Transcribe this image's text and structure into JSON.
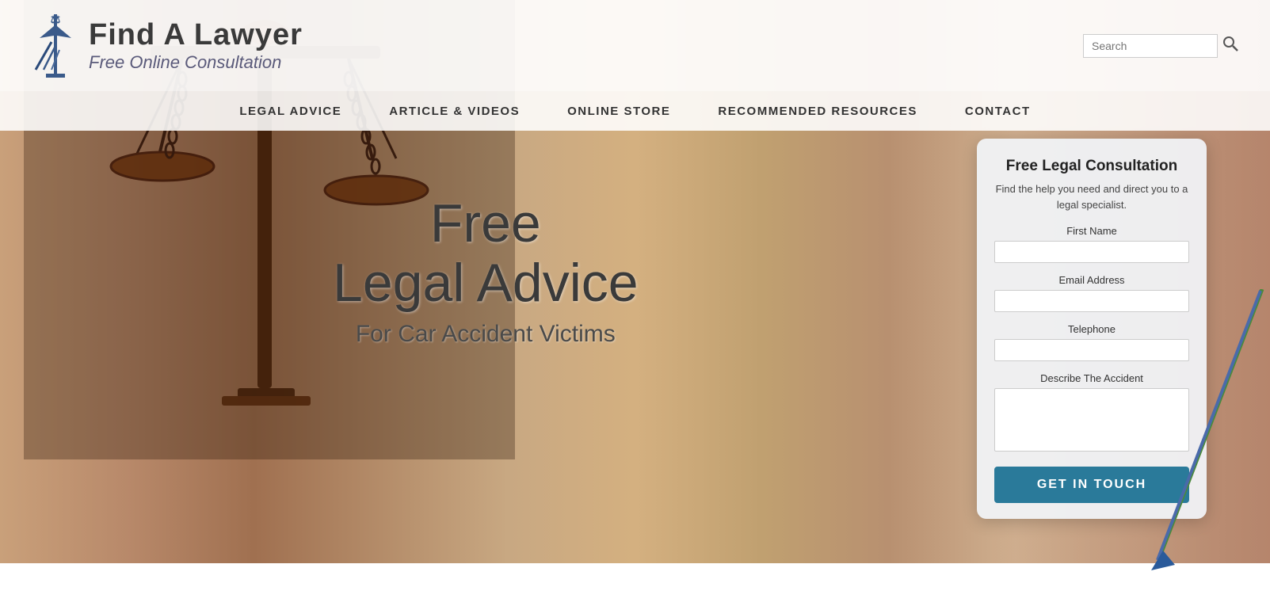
{
  "header": {
    "logo_title": "Find A Lawyer",
    "logo_subtitle": "Free Online Consultation",
    "search_placeholder": "Search",
    "search_icon": "🔍"
  },
  "nav": {
    "items": [
      {
        "label": "LEGAL ADVICE"
      },
      {
        "label": "ARTICLE & VIDEOS"
      },
      {
        "label": "ONLINE STORE"
      },
      {
        "label": "RECOMMENDED RESOURCES"
      },
      {
        "label": "CONTACT"
      }
    ]
  },
  "hero": {
    "line1": "Free",
    "line2": "Legal Advice",
    "subtitle": "For Car Accident Victims"
  },
  "card": {
    "title": "Free Legal Consultation",
    "description": "Find the help you need and direct you to a legal specialist.",
    "fields": {
      "first_name_label": "First Name",
      "email_label": "Email Address",
      "telephone_label": "Telephone",
      "accident_label": "Describe The Accident"
    },
    "button_label": "GET IN TOUCH"
  }
}
